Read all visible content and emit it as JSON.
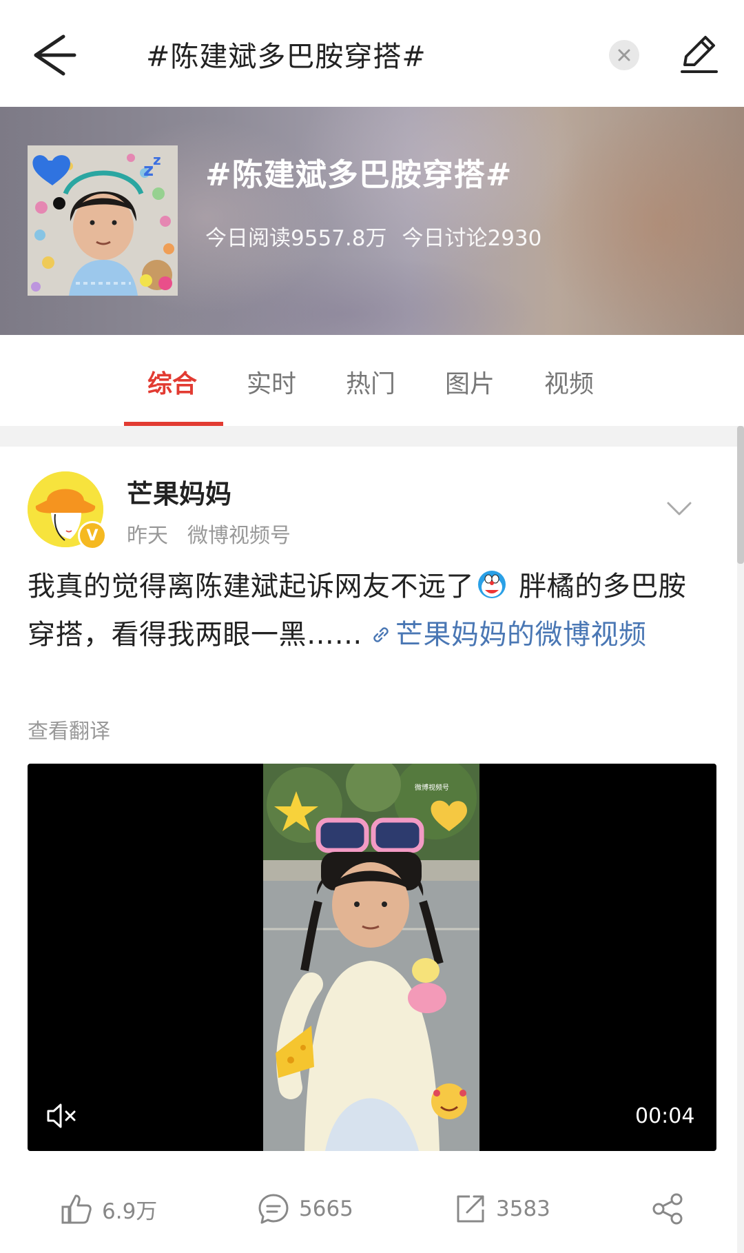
{
  "search": {
    "query": "#陈建斌多巴胺穿搭#"
  },
  "topic": {
    "title": "#陈建斌多巴胺穿搭#",
    "reads_today": "今日阅读9557.8万",
    "discussions_today": "今日讨论2930"
  },
  "tabs": [
    {
      "label": "综合",
      "active": true
    },
    {
      "label": "实时",
      "active": false
    },
    {
      "label": "热门",
      "active": false
    },
    {
      "label": "图片",
      "active": false
    },
    {
      "label": "视频",
      "active": false
    }
  ],
  "post": {
    "author": "芒果妈妈",
    "time": "昨天",
    "source": "微博视频号",
    "text_part1": "我真的觉得离陈建斌起诉网友不远了",
    "text_part2": " 胖橘的多巴胺穿搭，看得我两眼一黑……",
    "link_text": "芒果妈妈的微博视频",
    "translate_label": "查看翻译",
    "video": {
      "duration": "00:04",
      "watermark": "微博视频号"
    },
    "actions": {
      "likes": "6.9万",
      "comments": "5665",
      "reposts": "3583"
    }
  },
  "colors": {
    "accent": "#e23b32",
    "link": "#4a77b4",
    "muted": "#999999"
  }
}
